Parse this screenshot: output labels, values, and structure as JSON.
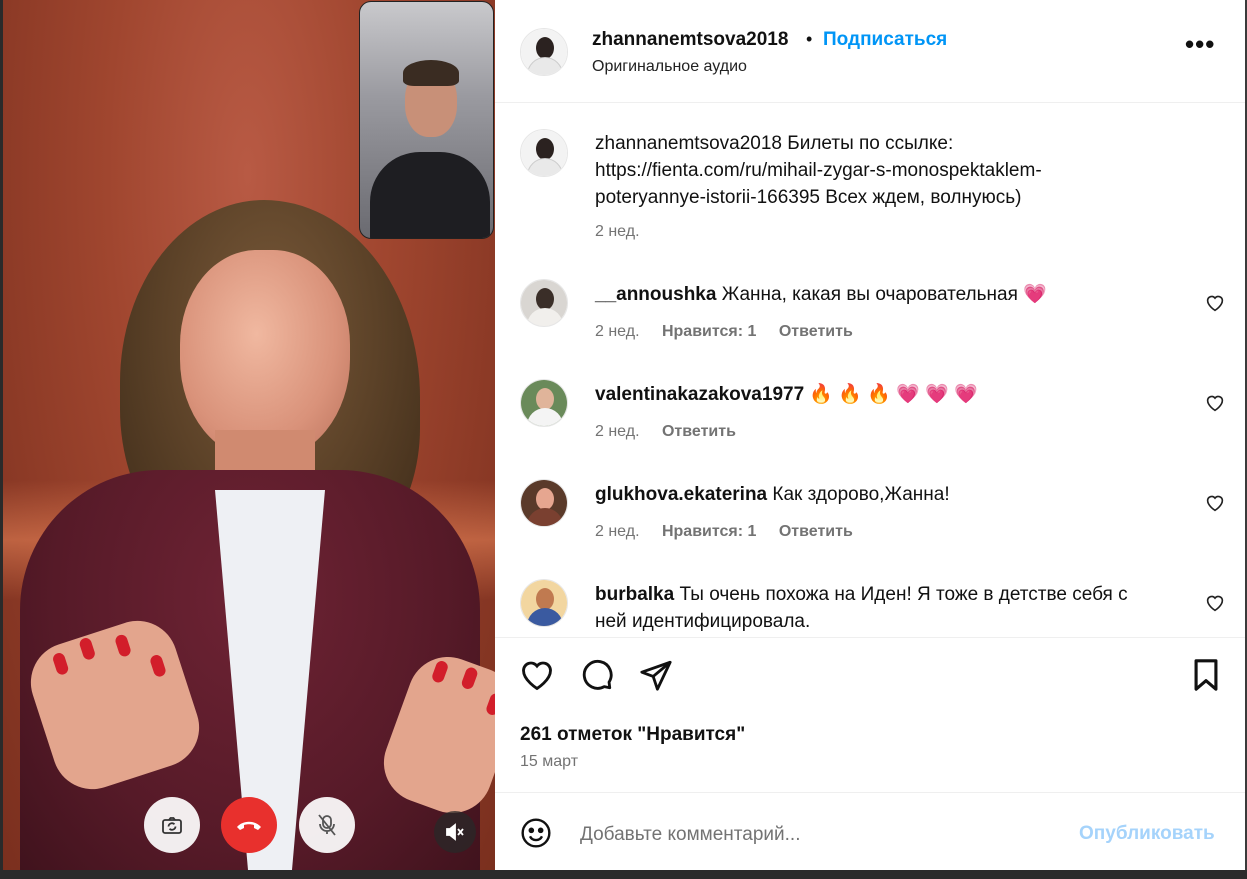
{
  "header": {
    "username": "zhannanemtsova2018",
    "separator": "•",
    "follow_label": "Подписаться",
    "audio_label": "Оригинальное аудио",
    "more_label": "•••"
  },
  "caption": {
    "username": "zhannanemtsova2018",
    "text_line1": "Билеты по ссылке:",
    "text_line2": "https://fienta.com/ru/mihail-zygar-s-monospektaklem-",
    "text_line3": "poteryannye-istorii-166395 Всех ждем, волнуюсь)",
    "time": "2 нед."
  },
  "comments": [
    {
      "username": "__annoushka",
      "text": "Жанна, какая вы очаровательная 💗",
      "time": "2 нед.",
      "likes": "Нравится: 1",
      "reply": "Ответить"
    },
    {
      "username": "valentinakazakova1977",
      "text": "🔥 🔥 🔥 💗 💗 💗",
      "time": "2 нед.",
      "reply": "Ответить"
    },
    {
      "username": "glukhova.ekaterina",
      "text": "Как здорово,Жанна!",
      "time": "2 нед.",
      "likes": "Нравится: 1",
      "reply": "Ответить"
    },
    {
      "username": "burbalka",
      "text_line1": "Ты очень похожа на Иден! Я тоже в детстве себя с",
      "text_line2": "ней идентифицировала."
    }
  ],
  "post": {
    "likes_text": "261 отметок \"Нравится\"",
    "date": "15 март"
  },
  "composer": {
    "placeholder": "Добавьте комментарий...",
    "publish_label": "Опубликовать"
  },
  "icons": {
    "like": "heart-icon",
    "comment": "comment-icon",
    "share": "share-icon",
    "save": "bookmark-icon",
    "emoji": "emoji-icon",
    "flip": "camera-flip-icon",
    "end": "end-call-icon",
    "mute": "mic-off-icon",
    "sound": "sound-off-icon"
  },
  "colors": {
    "accent": "#0095f6",
    "publish_disabled": "#a5d3fb",
    "end_call": "#e8302d",
    "heart_emoji": "#e83a6a"
  }
}
